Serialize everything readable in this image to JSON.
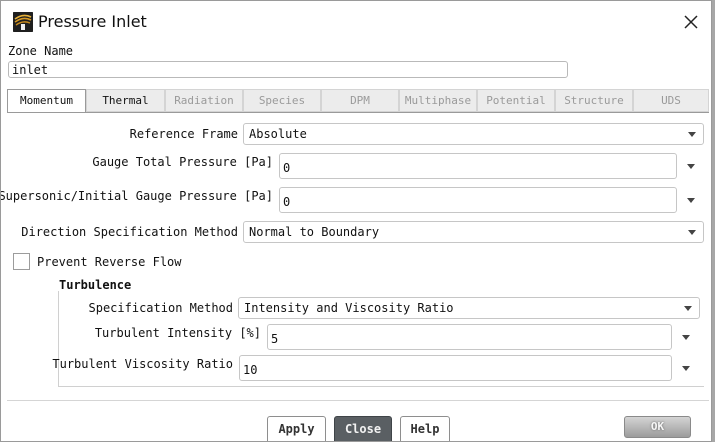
{
  "window": {
    "title": "Pressure Inlet",
    "app_icon": "fluent-logo-icon",
    "close_icon": "close-icon"
  },
  "zone": {
    "label": "Zone Name",
    "value": "inlet"
  },
  "tabs": [
    {
      "label": "Momentum",
      "active": true,
      "enabled": true
    },
    {
      "label": "Thermal",
      "active": false,
      "enabled": true
    },
    {
      "label": "Radiation",
      "active": false,
      "enabled": false
    },
    {
      "label": "Species",
      "active": false,
      "enabled": false
    },
    {
      "label": "DPM",
      "active": false,
      "enabled": false
    },
    {
      "label": "Multiphase",
      "active": false,
      "enabled": false
    },
    {
      "label": "Potential",
      "active": false,
      "enabled": false
    },
    {
      "label": "Structure",
      "active": false,
      "enabled": false
    },
    {
      "label": "UDS",
      "active": false,
      "enabled": false
    }
  ],
  "momentum": {
    "reference_frame": {
      "label": "Reference Frame",
      "value": "Absolute"
    },
    "gauge_total_pressure": {
      "label": "Gauge Total Pressure [Pa]",
      "value": "0"
    },
    "initial_gauge_pressure": {
      "label": "Supersonic/Initial Gauge Pressure [Pa]",
      "value": "0"
    },
    "direction_method": {
      "label": "Direction Specification Method",
      "value": "Normal to Boundary"
    },
    "prevent_reverse_flow": {
      "label": "Prevent Reverse Flow",
      "checked": false
    }
  },
  "turbulence": {
    "title": "Turbulence",
    "spec_method": {
      "label": "Specification Method",
      "value": "Intensity and Viscosity Ratio"
    },
    "intensity": {
      "label": "Turbulent Intensity [%]",
      "value": "5"
    },
    "viscosity_ratio": {
      "label": "Turbulent Viscosity Ratio",
      "value": "10"
    }
  },
  "buttons": {
    "apply": "Apply",
    "close": "Close",
    "help": "Help",
    "extra": "OK"
  },
  "colors": {
    "close_button_bg": "#5a5f63",
    "tab_disabled_text": "#9a9a9a",
    "background_behind": "#a7a7a7"
  }
}
